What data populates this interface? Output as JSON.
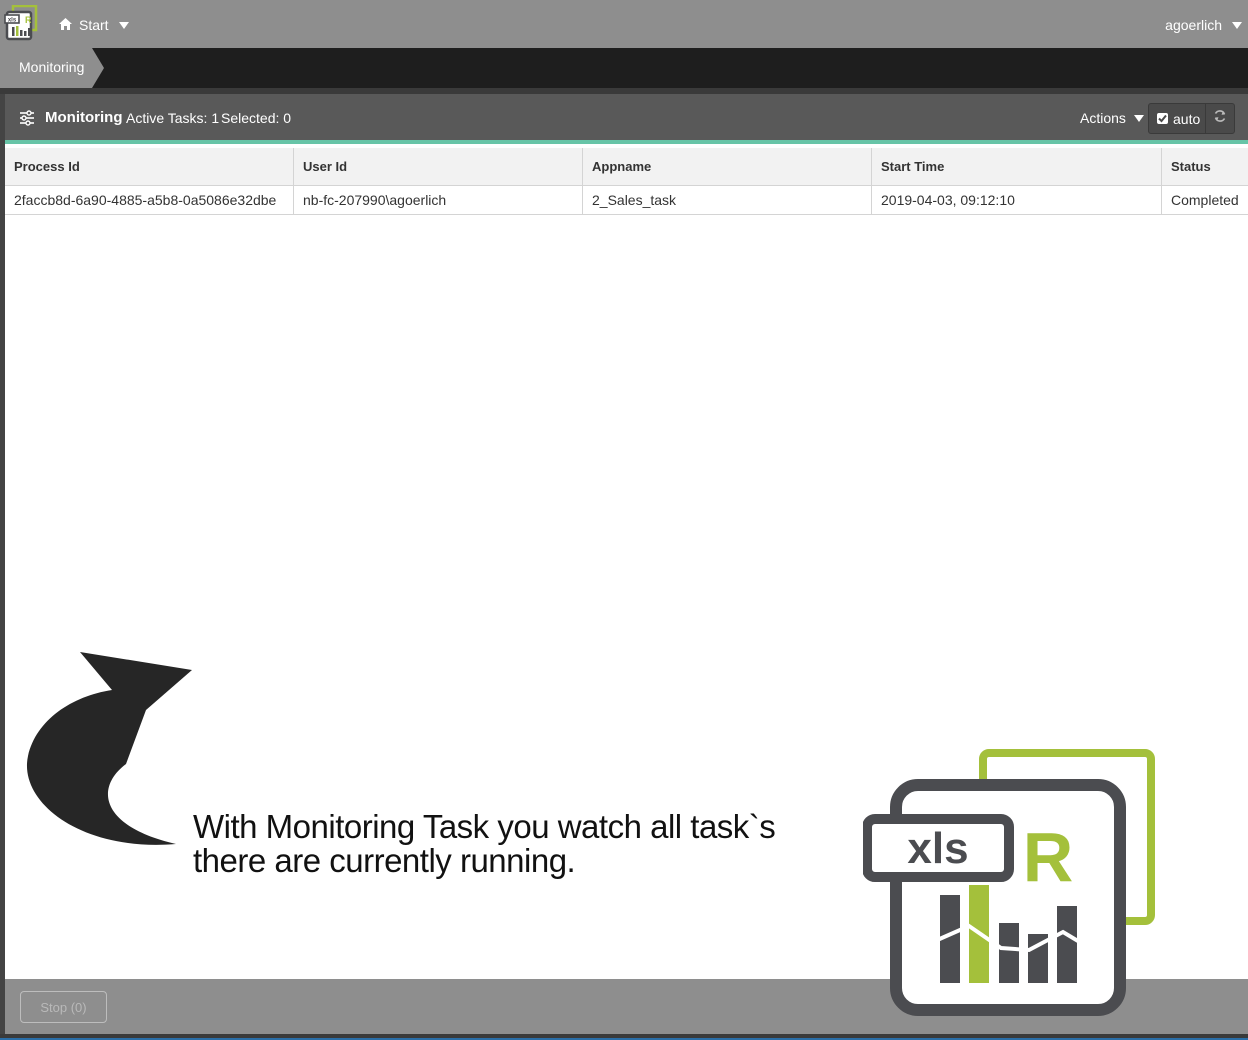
{
  "topbar": {
    "app_icon": "xlsr-app-icon",
    "home_icon": "home-icon",
    "start_label": "Start",
    "user_label": "agoerlich"
  },
  "breadcrumb": {
    "current": "Monitoring"
  },
  "panel": {
    "icon": "sliders-icon",
    "title": "Monitoring",
    "active_tasks": "Active Tasks: 1",
    "selected": "Selected: 0",
    "actions_label": "Actions",
    "auto_label": "auto",
    "auto_checked": true,
    "refresh_icon": "refresh-icon"
  },
  "table": {
    "columns": [
      "Process Id",
      "User Id",
      "Appname",
      "Start Time",
      "Status"
    ],
    "rows": [
      [
        "2faccb8d-6a90-4885-a5b8-0a5086e32dbe",
        "nb-fc-207990\\agoerlich",
        "2_Sales_task",
        "2019-04-03, 09:12:10",
        "Completed"
      ]
    ]
  },
  "footer": {
    "stop_label": "Stop (0)"
  },
  "annotation": {
    "caption_line1": "With Monitoring Task you watch all task`s",
    "caption_line2": "there are currently running.",
    "arrow_icon": "curved-arrow-icon"
  },
  "logo": {
    "xls_text": "xls",
    "r_text": "R"
  },
  "colors": {
    "topbar": "#8e8e8e",
    "accent_green": "#a4c03b",
    "logo_dark": "#4b4c50",
    "header_underline": "#67c4a7"
  }
}
